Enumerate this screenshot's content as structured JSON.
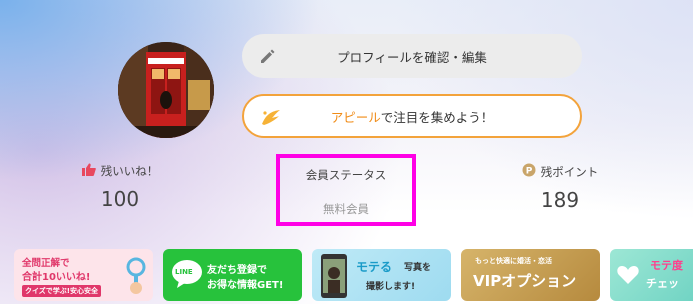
{
  "profile": {
    "edit_button_label": "プロフィールを確認・編集",
    "appeal_highlight": "アピール",
    "appeal_rest": "で注目を集めよう！"
  },
  "stats": {
    "likes_label": "残いいね！",
    "likes_value": "100",
    "member_status_label": "会員ステータス",
    "member_status_value": "無料会員",
    "points_label": "残ポイント",
    "points_value": "189"
  },
  "banners": {
    "quiz": {
      "line1": "全問正解で",
      "line2": "合計10いいね!",
      "line3": "クイズで学ぶ!安心安全"
    },
    "line": {
      "logo": "LINE",
      "line1": "友だち登録で",
      "line2": "お得な情報GET!"
    },
    "motel": {
      "title": "モテる",
      "line1": "写真を",
      "line2": "撮影します!"
    },
    "vip": {
      "small": "もっと快適に婚活・恋活",
      "title": "VIPオプション"
    },
    "check": {
      "line1": "モテ度",
      "line2": "チェッ"
    }
  },
  "colors": {
    "accent_orange": "#f3a33b",
    "highlight_border": "#ff00e6",
    "like_red": "#e8485f",
    "point_gold": "#c9a56a",
    "line_green": "#27c23c"
  }
}
